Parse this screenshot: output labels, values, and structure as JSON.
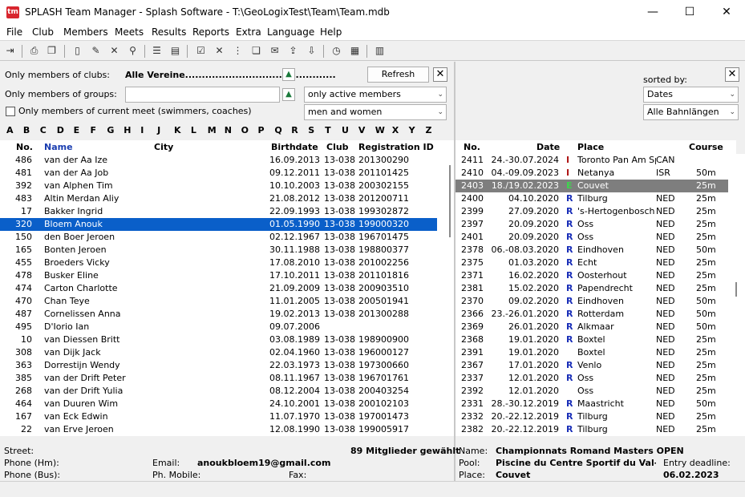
{
  "window": {
    "app_icon_text": "tm",
    "title": "SPLASH Team Manager - Splash Software - T:\\GeoLogixTest\\Team\\Team.mdb",
    "minimize": "—",
    "maximize": "☐",
    "close": "✕"
  },
  "menu": [
    "File",
    "Club",
    "Members",
    "Meets",
    "Results",
    "Reports",
    "Extra",
    "Language",
    "Help"
  ],
  "left_filter": {
    "clubs_label": "Only members of clubs:",
    "clubs_value": "Alle Vereine.............................................",
    "groups_label": "Only members of groups:",
    "groups_value": "",
    "current_meet_label": "Only members of current meet (swimmers, coaches)",
    "refresh": "Refresh",
    "active_select": "only active members",
    "gender_select": "men and women"
  },
  "alphabet": [
    "A",
    "B",
    "C",
    "D",
    "E",
    "F",
    "G",
    "H",
    "I",
    "J",
    "K",
    "L",
    "M",
    "N",
    "O",
    "P",
    "Q",
    "R",
    "S",
    "T",
    "U",
    "V",
    "W",
    "X",
    "Y",
    "Z"
  ],
  "members": {
    "headers": {
      "no": "No.",
      "name": "Name",
      "city": "City",
      "birthdate": "Birthdate",
      "club": "Club",
      "reg_id": "Registration ID"
    },
    "rows": [
      {
        "no": "486",
        "name": "van der Aa Ize",
        "birthdate": "16.09.2013",
        "club": "13-038",
        "reg": "201300290"
      },
      {
        "no": "481",
        "name": "van der Aa Job",
        "birthdate": "09.12.2011",
        "club": "13-038",
        "reg": "201101425"
      },
      {
        "no": "392",
        "name": "van Alphen Tim",
        "birthdate": "10.10.2003",
        "club": "13-038",
        "reg": "200302155"
      },
      {
        "no": "483",
        "name": "Altin Merdan Aliy",
        "birthdate": "21.08.2012",
        "club": "13-038",
        "reg": "201200711"
      },
      {
        "no": "17",
        "name": "Bakker Ingrid",
        "birthdate": "22.09.1993",
        "club": "13-038",
        "reg": "199302872"
      },
      {
        "no": "320",
        "name": "Bloem Anouk",
        "birthdate": "01.05.1990",
        "club": "13-038",
        "reg": "199000320",
        "selected": true
      },
      {
        "no": "150",
        "name": "den Boer Jeroen",
        "birthdate": "02.12.1967",
        "club": "13-038",
        "reg": "196701475"
      },
      {
        "no": "165",
        "name": "Bonten Jeroen",
        "birthdate": "30.11.1988",
        "club": "13-038",
        "reg": "198800377"
      },
      {
        "no": "455",
        "name": "Broeders Vicky",
        "birthdate": "17.08.2010",
        "club": "13-038",
        "reg": "201002256"
      },
      {
        "no": "478",
        "name": "Busker Eline",
        "birthdate": "17.10.2011",
        "club": "13-038",
        "reg": "201101816"
      },
      {
        "no": "474",
        "name": "Carton Charlotte",
        "birthdate": "21.09.2009",
        "club": "13-038",
        "reg": "200903510"
      },
      {
        "no": "470",
        "name": "Chan Teye",
        "birthdate": "11.01.2005",
        "club": "13-038",
        "reg": "200501941"
      },
      {
        "no": "487",
        "name": "Cornelissen Anna",
        "birthdate": "19.02.2013",
        "club": "13-038",
        "reg": "201300288"
      },
      {
        "no": "495",
        "name": "D'Iorio Ian",
        "birthdate": "09.07.2006",
        "club": "",
        "reg": ""
      },
      {
        "no": "10",
        "name": "van Diessen Britt",
        "birthdate": "03.08.1989",
        "club": "13-038",
        "reg": "198900900"
      },
      {
        "no": "308",
        "name": "van Dijk Jack",
        "birthdate": "02.04.1960",
        "club": "13-038",
        "reg": "196000127"
      },
      {
        "no": "363",
        "name": "Dorrestijn Wendy",
        "birthdate": "22.03.1973",
        "club": "13-038",
        "reg": "197300660"
      },
      {
        "no": "385",
        "name": "van der Drift Peter",
        "birthdate": "08.11.1967",
        "club": "13-038",
        "reg": "196701761"
      },
      {
        "no": "268",
        "name": "van der Drift Yulia",
        "birthdate": "08.12.2004",
        "club": "13-038",
        "reg": "200403254"
      },
      {
        "no": "464",
        "name": "van Duuren Wim",
        "birthdate": "24.10.2001",
        "club": "13-038",
        "reg": "200102103"
      },
      {
        "no": "167",
        "name": "van Eck Edwin",
        "birthdate": "11.07.1970",
        "club": "13-038",
        "reg": "197001473"
      },
      {
        "no": "22",
        "name": "van Erve Jeroen",
        "birthdate": "12.08.1990",
        "club": "13-038",
        "reg": "199005917"
      }
    ]
  },
  "right_filter": {
    "sorted_by": "sorted by:",
    "sort_select": "Dates",
    "course_select": "Alle Bahnlängen"
  },
  "meets": {
    "headers": {
      "no": "No.",
      "date": "Date",
      "place": "Place",
      "course": "Course"
    },
    "rows": [
      {
        "no": "2411",
        "date": "24.-30.07.2024",
        "code": "I",
        "place": "Toronto Pan Am Spc",
        "nation": "CAN",
        "course": ""
      },
      {
        "no": "2410",
        "date": "04.-09.09.2023",
        "code": "I",
        "place": "Netanya",
        "nation": "ISR",
        "course": "50m"
      },
      {
        "no": "2403",
        "date": "18./19.02.2023",
        "code": "E",
        "place": "Couvet",
        "nation": "",
        "course": "25m",
        "selected": true
      },
      {
        "no": "2400",
        "date": "04.10.2020",
        "code": "R",
        "place": "Tilburg",
        "nation": "NED",
        "course": "25m"
      },
      {
        "no": "2399",
        "date": "27.09.2020",
        "code": "R",
        "place": "'s-Hertogenbosch",
        "nation": "NED",
        "course": "25m"
      },
      {
        "no": "2397",
        "date": "20.09.2020",
        "code": "R",
        "place": "Oss",
        "nation": "NED",
        "course": "25m"
      },
      {
        "no": "2401",
        "date": "20.09.2020",
        "code": "R",
        "place": "Oss",
        "nation": "NED",
        "course": "25m"
      },
      {
        "no": "2378",
        "date": "06.-08.03.2020",
        "code": "R",
        "place": "Eindhoven",
        "nation": "NED",
        "course": "50m"
      },
      {
        "no": "2375",
        "date": "01.03.2020",
        "code": "R",
        "place": "Echt",
        "nation": "NED",
        "course": "25m"
      },
      {
        "no": "2371",
        "date": "16.02.2020",
        "code": "R",
        "place": "Oosterhout",
        "nation": "NED",
        "course": "25m"
      },
      {
        "no": "2381",
        "date": "15.02.2020",
        "code": "R",
        "place": "Papendrecht",
        "nation": "NED",
        "course": "25m"
      },
      {
        "no": "2370",
        "date": "09.02.2020",
        "code": "R",
        "place": "Eindhoven",
        "nation": "NED",
        "course": "50m"
      },
      {
        "no": "2366",
        "date": "23.-26.01.2020",
        "code": "R",
        "place": "Rotterdam",
        "nation": "NED",
        "course": "50m"
      },
      {
        "no": "2369",
        "date": "26.01.2020",
        "code": "R",
        "place": "Alkmaar",
        "nation": "NED",
        "course": "50m"
      },
      {
        "no": "2368",
        "date": "19.01.2020",
        "code": "R",
        "place": "Boxtel",
        "nation": "NED",
        "course": "25m"
      },
      {
        "no": "2391",
        "date": "19.01.2020",
        "code": "",
        "place": "Boxtel",
        "nation": "NED",
        "course": "25m"
      },
      {
        "no": "2367",
        "date": "17.01.2020",
        "code": "R",
        "place": "Venlo",
        "nation": "NED",
        "course": "25m"
      },
      {
        "no": "2337",
        "date": "12.01.2020",
        "code": "R",
        "place": "Oss",
        "nation": "NED",
        "course": "25m"
      },
      {
        "no": "2392",
        "date": "12.01.2020",
        "code": "",
        "place": "Oss",
        "nation": "NED",
        "course": "25m"
      },
      {
        "no": "2331",
        "date": "28.-30.12.2019",
        "code": "R",
        "place": "Maastricht",
        "nation": "NED",
        "course": "50m"
      },
      {
        "no": "2332",
        "date": "20.-22.12.2019",
        "code": "R",
        "place": "Tilburg",
        "nation": "NED",
        "course": "25m"
      },
      {
        "no": "2382",
        "date": "20.-22.12.2019",
        "code": "R",
        "place": "Tilburg",
        "nation": "NED",
        "course": "25m"
      }
    ]
  },
  "member_status": {
    "street_label": "Street:",
    "count": "89 Mitglieder gewählt",
    "phone_hm_label": "Phone (Hm):",
    "email_label": "Email:",
    "email_value": "anoukbloem19@gmail.com",
    "phone_bus_label": "Phone (Bus):",
    "mobile_label": "Ph. Mobile:",
    "fax_label": "Fax:"
  },
  "meet_status": {
    "name_label": "Name:",
    "name_value": "Championnats Romand Masters OPEN",
    "pool_label": "Pool:",
    "pool_value": "Piscine du Centre Sportif du Val-de-",
    "deadline_label": "Entry deadline:",
    "place_label": "Place:",
    "place_value": "Couvet",
    "deadline_value": "06.02.2023"
  },
  "colors": {
    "select_blue": "#0a5fc9",
    "select_gray": "#7e7e7e",
    "name_header": "#1a3db0",
    "code_R": "#1a2fb8",
    "code_I": "#b01818",
    "code_E": "#1d8a2e"
  }
}
